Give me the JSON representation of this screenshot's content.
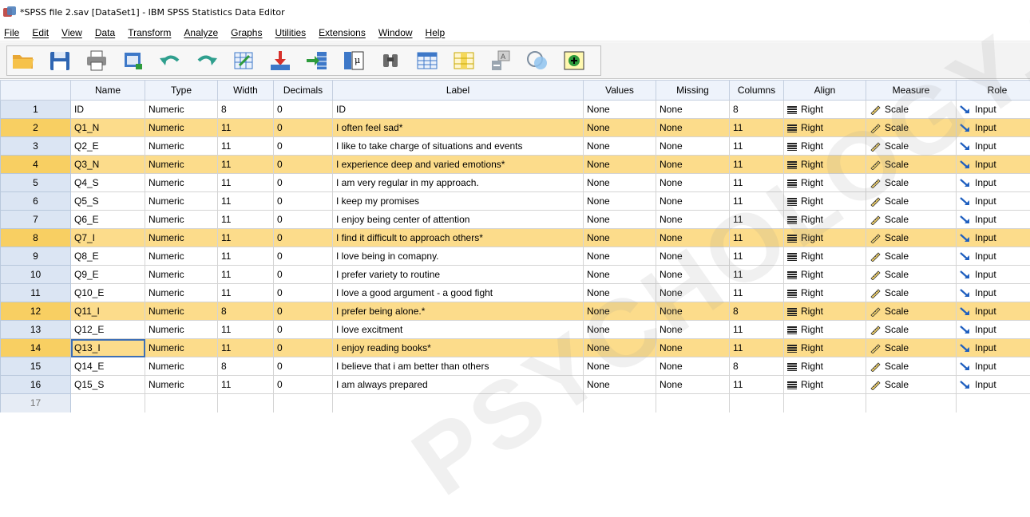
{
  "window": {
    "title": "*SPSS file 2.sav [DataSet1] - IBM SPSS Statistics Data Editor"
  },
  "menu": [
    "File",
    "Edit",
    "View",
    "Data",
    "Transform",
    "Analyze",
    "Graphs",
    "Utilities",
    "Extensions",
    "Window",
    "Help"
  ],
  "toolbar": {
    "icons": [
      "open-icon",
      "save-icon",
      "print-icon",
      "dialog-recall-icon",
      "undo-icon",
      "redo-icon",
      "goto-case-icon",
      "goto-variable-icon",
      "variables-icon",
      "run-descriptives-icon",
      "find-icon",
      "insert-cases-icon",
      "insert-variable-icon",
      "split-file-icon",
      "weight-cases-icon",
      "select-cases-icon",
      "value-labels-icon",
      "use-sets-icon"
    ]
  },
  "columns": [
    "Name",
    "Type",
    "Width",
    "Decimals",
    "Label",
    "Values",
    "Missing",
    "Columns",
    "Align",
    "Measure",
    "Role"
  ],
  "rows": [
    {
      "num": "1",
      "name": "ID",
      "type": "Numeric",
      "width": "8",
      "decimals": "0",
      "label": "ID",
      "values": "None",
      "missing": "None",
      "columns": "8",
      "align": "Right",
      "measure": "Scale",
      "role": "Input",
      "highlight": false
    },
    {
      "num": "2",
      "name": "Q1_N",
      "type": "Numeric",
      "width": "11",
      "decimals": "0",
      "label": "I often feel sad*",
      "values": "None",
      "missing": "None",
      "columns": "11",
      "align": "Right",
      "measure": "Scale",
      "role": "Input",
      "highlight": true
    },
    {
      "num": "3",
      "name": "Q2_E",
      "type": "Numeric",
      "width": "11",
      "decimals": "0",
      "label": "I like to take charge of situations and events",
      "values": "None",
      "missing": "None",
      "columns": "11",
      "align": "Right",
      "measure": "Scale",
      "role": "Input",
      "highlight": false
    },
    {
      "num": "4",
      "name": "Q3_N",
      "type": "Numeric",
      "width": "11",
      "decimals": "0",
      "label": "I experience deep and varied emotions*",
      "values": "None",
      "missing": "None",
      "columns": "11",
      "align": "Right",
      "measure": "Scale",
      "role": "Input",
      "highlight": true
    },
    {
      "num": "5",
      "name": "Q4_S",
      "type": "Numeric",
      "width": "11",
      "decimals": "0",
      "label": "I am very regular in my approach.",
      "values": "None",
      "missing": "None",
      "columns": "11",
      "align": "Right",
      "measure": "Scale",
      "role": "Input",
      "highlight": false
    },
    {
      "num": "6",
      "name": "Q5_S",
      "type": "Numeric",
      "width": "11",
      "decimals": "0",
      "label": "I keep my promises",
      "values": "None",
      "missing": "None",
      "columns": "11",
      "align": "Right",
      "measure": "Scale",
      "role": "Input",
      "highlight": false
    },
    {
      "num": "7",
      "name": "Q6_E",
      "type": "Numeric",
      "width": "11",
      "decimals": "0",
      "label": "I enjoy being center of attention",
      "values": "None",
      "missing": "None",
      "columns": "11",
      "align": "Right",
      "measure": "Scale",
      "role": "Input",
      "highlight": false
    },
    {
      "num": "8",
      "name": "Q7_I",
      "type": "Numeric",
      "width": "11",
      "decimals": "0",
      "label": "I find it difficult to approach others*",
      "values": "None",
      "missing": "None",
      "columns": "11",
      "align": "Right",
      "measure": "Scale",
      "role": "Input",
      "highlight": true
    },
    {
      "num": "9",
      "name": "Q8_E",
      "type": "Numeric",
      "width": "11",
      "decimals": "0",
      "label": "I love being in comapny.",
      "values": "None",
      "missing": "None",
      "columns": "11",
      "align": "Right",
      "measure": "Scale",
      "role": "Input",
      "highlight": false
    },
    {
      "num": "10",
      "name": "Q9_E",
      "type": "Numeric",
      "width": "11",
      "decimals": "0",
      "label": "I prefer variety to routine",
      "values": "None",
      "missing": "None",
      "columns": "11",
      "align": "Right",
      "measure": "Scale",
      "role": "Input",
      "highlight": false
    },
    {
      "num": "11",
      "name": "Q10_E",
      "type": "Numeric",
      "width": "11",
      "decimals": "0",
      "label": "I love a good argument - a good fight",
      "values": "None",
      "missing": "None",
      "columns": "11",
      "align": "Right",
      "measure": "Scale",
      "role": "Input",
      "highlight": false
    },
    {
      "num": "12",
      "name": "Q11_I",
      "type": "Numeric",
      "width": "8",
      "decimals": "0",
      "label": "I prefer being alone.*",
      "values": "None",
      "missing": "None",
      "columns": "8",
      "align": "Right",
      "measure": "Scale",
      "role": "Input",
      "highlight": true
    },
    {
      "num": "13",
      "name": "Q12_E",
      "type": "Numeric",
      "width": "11",
      "decimals": "0",
      "label": "I love excitment",
      "values": "None",
      "missing": "None",
      "columns": "11",
      "align": "Right",
      "measure": "Scale",
      "role": "Input",
      "highlight": false
    },
    {
      "num": "14",
      "name": "Q13_I",
      "type": "Numeric",
      "width": "11",
      "decimals": "0",
      "label": "I enjoy reading books*",
      "values": "None",
      "missing": "None",
      "columns": "11",
      "align": "Right",
      "measure": "Scale",
      "role": "Input",
      "highlight": true,
      "selected": true
    },
    {
      "num": "15",
      "name": "Q14_E",
      "type": "Numeric",
      "width": "8",
      "decimals": "0",
      "label": "I believe that i am better than others",
      "values": "None",
      "missing": "None",
      "columns": "8",
      "align": "Right",
      "measure": "Scale",
      "role": "Input",
      "highlight": false
    },
    {
      "num": "16",
      "name": "Q15_S",
      "type": "Numeric",
      "width": "11",
      "decimals": "0",
      "label": "I am always prepared",
      "values": "None",
      "missing": "None",
      "columns": "11",
      "align": "Right",
      "measure": "Scale",
      "role": "Input",
      "highlight": false
    }
  ],
  "empty_row": "17",
  "watermark": "PSYCHOLOGY.CO",
  "colors": {
    "highlight_row": "#fcdc8b",
    "header_bg": "#eef3fb",
    "rownum_bg": "#dbe5f3",
    "selection": "#3d6fb6"
  }
}
